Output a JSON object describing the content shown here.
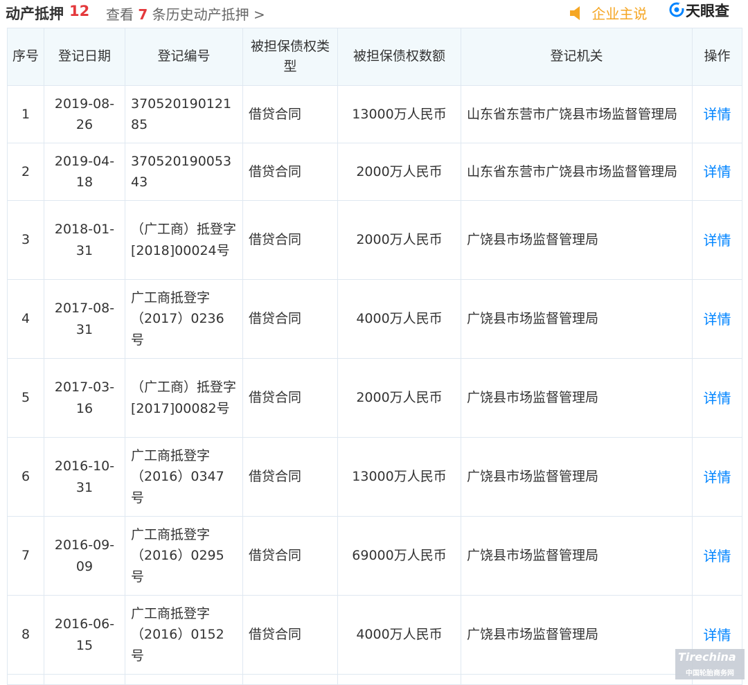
{
  "header": {
    "title": "动产抵押",
    "count": "12",
    "history_prefix": "查看",
    "history_count": "7",
    "history_suffix": "条历史动产抵押 >",
    "company_say": "企业主说",
    "logo_text": "天眼查"
  },
  "colors": {
    "accent_red": "#e4393c",
    "link_blue": "#0084ff",
    "gold": "#f5a623",
    "header_bg": "#f2f9fc",
    "border": "#dfe8f1"
  },
  "table": {
    "columns": [
      "序号",
      "登记日期",
      "登记编号",
      "被担保债权类型",
      "被担保债权数额",
      "登记机关",
      "操作"
    ],
    "rows": [
      {
        "no": "1",
        "date": "2019-08-26",
        "reg_no": "370520190121 85",
        "type": "借贷合同",
        "amount": "13000万人民币",
        "authority": "山东省东营市广饶县市场监督管理局",
        "action": "详情"
      },
      {
        "no": "2",
        "date": "2019-04-18",
        "reg_no": "370520190053 43",
        "type": "借贷合同",
        "amount": "2000万人民币",
        "authority": "山东省东营市广饶县市场监督管理局",
        "action": "详情"
      },
      {
        "no": "3",
        "date": "2018-01-31",
        "reg_no": "（广工商）抵登字[2018]00024号",
        "type": "借贷合同",
        "amount": "2000万人民币",
        "authority": "广饶县市场监督管理局",
        "action": "详情"
      },
      {
        "no": "4",
        "date": "2017-08-31",
        "reg_no": "广工商抵登字（2017）0236号",
        "type": "借贷合同",
        "amount": "4000万人民币",
        "authority": "广饶县市场监督管理局",
        "action": "详情"
      },
      {
        "no": "5",
        "date": "2017-03-16",
        "reg_no": "（广工商）抵登字[2017]00082号",
        "type": "借贷合同",
        "amount": "2000万人民币",
        "authority": "广饶县市场监督管理局",
        "action": "详情"
      },
      {
        "no": "6",
        "date": "2016-10-31",
        "reg_no": "广工商抵登字（2016）0347号",
        "type": "借贷合同",
        "amount": "13000万人民币",
        "authority": "广饶县市场监督管理局",
        "action": "详情"
      },
      {
        "no": "7",
        "date": "2016-09-09",
        "reg_no": "广工商抵登字（2016）0295号",
        "type": "借贷合同",
        "amount": "69000万人民币",
        "authority": "广饶县市场监督管理局",
        "action": "详情"
      },
      {
        "no": "8",
        "date": "2016-06-15",
        "reg_no": "广工商抵登字（2016）0152号",
        "type": "借贷合同",
        "amount": "4000万人民币",
        "authority": "广饶县市场监督管理局",
        "action": "详情"
      }
    ]
  },
  "watermark": {
    "logo": "Tirechina",
    "text": "中国轮胎商务网"
  }
}
